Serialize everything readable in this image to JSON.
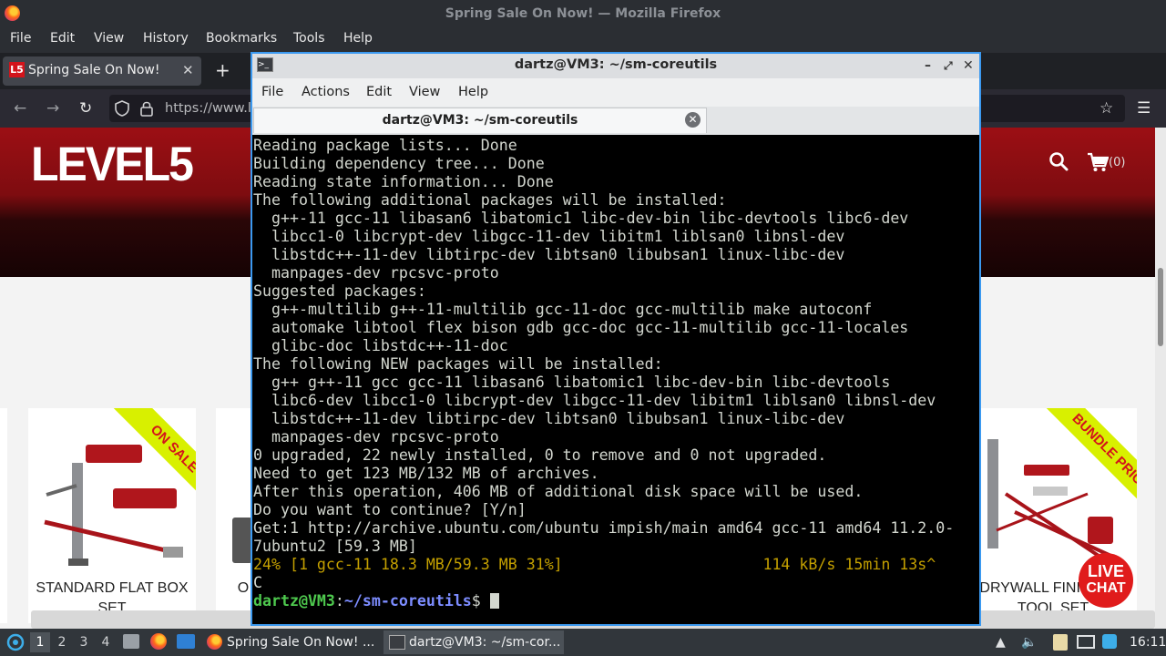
{
  "firefox": {
    "window_title": "Spring Sale On Now! — Mozilla Firefox",
    "menu": [
      "File",
      "Edit",
      "View",
      "History",
      "Bookmarks",
      "Tools",
      "Help"
    ],
    "tab": {
      "favicon_text": "L5",
      "title": "Spring Sale On Now!",
      "close": "✕"
    },
    "new_tab": "+",
    "url": "https://www.l"
  },
  "site": {
    "logo": "LEVEL5",
    "cart_count": "(0)",
    "products": [
      {
        "name": "STANDARD FLAT BOX SET",
        "ribbon": "ON SALE"
      },
      {
        "name": "O"
      },
      {
        "name": "DRYWALL FINISHING TOOL SET",
        "ribbon": "BUNDLE PRICE"
      }
    ],
    "live_chat": {
      "line1": "LIVE",
      "line2": "CHAT"
    }
  },
  "terminal": {
    "window_title": "dartz@VM3: ~/sm-coreutils",
    "menu": [
      "File",
      "Actions",
      "Edit",
      "View",
      "Help"
    ],
    "tab_title": "dartz@VM3: ~/sm-coreutils",
    "output": "Reading package lists... Done\nBuilding dependency tree... Done\nReading state information... Done\nThe following additional packages will be installed:\n  g++-11 gcc-11 libasan6 libatomic1 libc-dev-bin libc-devtools libc6-dev\n  libcc1-0 libcrypt-dev libgcc-11-dev libitm1 liblsan0 libnsl-dev\n  libstdc++-11-dev libtirpc-dev libtsan0 libubsan1 linux-libc-dev\n  manpages-dev rpcsvc-proto\nSuggested packages:\n  g++-multilib g++-11-multilib gcc-11-doc gcc-multilib make autoconf\n  automake libtool flex bison gdb gcc-doc gcc-11-multilib gcc-11-locales\n  glibc-doc libstdc++-11-doc\nThe following NEW packages will be installed:\n  g++ g++-11 gcc gcc-11 libasan6 libatomic1 libc-dev-bin libc-devtools\n  libc6-dev libcc1-0 libcrypt-dev libgcc-11-dev libitm1 liblsan0 libnsl-dev\n  libstdc++-11-dev libtirpc-dev libtsan0 libubsan1 linux-libc-dev\n  manpages-dev rpcsvc-proto\n0 upgraded, 22 newly installed, 0 to remove and 0 not upgraded.\nNeed to get 123 MB/132 MB of archives.\nAfter this operation, 406 MB of additional disk space will be used.\nDo you want to continue? [Y/n]\nGet:1 http://archive.ubuntu.com/ubuntu impish/main amd64 gcc-11 amd64 11.2.0-\n7ubuntu2 [59.3 MB]",
    "progress_line": "24% [1 gcc-11 18.3 MB/59.3 MB 31%]                      114 kB/s 15min 13s^",
    "interrupt_line": "C",
    "prompt_user": "dartz@VM3",
    "prompt_sep": ":",
    "prompt_path": "~/sm-coreutils",
    "prompt_symbol": "$ "
  },
  "taskbar": {
    "workspaces": [
      "1",
      "2",
      "3",
      "4"
    ],
    "tasks": [
      {
        "label": "Spring Sale On Now! ..."
      },
      {
        "label": "dartz@VM3: ~/sm-cor..."
      }
    ],
    "clock": "16:11"
  },
  "colors": {
    "terminal_border": "#3b99f0",
    "brand_red": "#d3141b",
    "prompt_green": "#4ec94e",
    "prompt_blue": "#7c8cff",
    "progress_yellow": "#c4a000"
  }
}
